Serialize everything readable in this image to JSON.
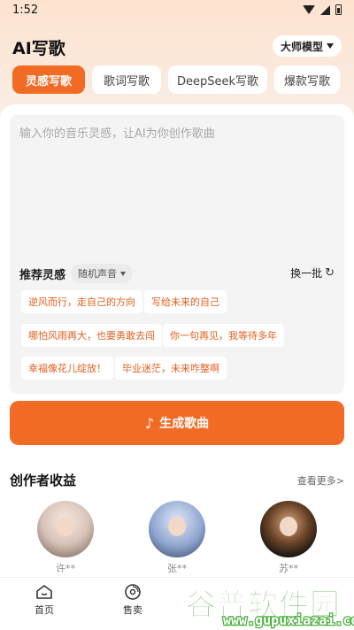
{
  "status": {
    "time": "1:52"
  },
  "header": {
    "title": "AI写歌",
    "model_label": "大师模型"
  },
  "tabs": [
    {
      "label": "灵感写歌",
      "active": true
    },
    {
      "label": "歌词写歌",
      "active": false
    },
    {
      "label": "DeepSeek写歌",
      "active": false
    },
    {
      "label": "爆款写歌",
      "active": false
    }
  ],
  "input": {
    "placeholder": "输入你的音乐灵感，让AI为你创作歌曲"
  },
  "recommend": {
    "title": "推荐灵感",
    "voice_label": "随机声音",
    "refresh_label": "换一批",
    "chips": [
      "逆风而行，走自己的方向",
      "写给未来的自己",
      "哪怕风雨再大，也要勇敢去闯",
      "你一句再见，我等待多年",
      "幸福像花儿绽放！",
      "毕业迷茫，未来咋整啊"
    ]
  },
  "generate": {
    "label": "生成歌曲"
  },
  "creators": {
    "title": "创作者收益",
    "see_more": "查看更多>",
    "items": [
      {
        "name": "许**"
      },
      {
        "name": "张**"
      },
      {
        "name": "苏**"
      }
    ]
  },
  "nav": [
    {
      "label": "首页",
      "icon": "home-icon"
    },
    {
      "label": "售卖",
      "icon": "disc-icon"
    }
  ],
  "watermark": {
    "main": "谷普软件园",
    "url": "www.gupuxiazai.com"
  },
  "colors": {
    "accent": "#f26b25",
    "chip_text": "#e25f1e",
    "watermark_green": "#4cae3e"
  }
}
